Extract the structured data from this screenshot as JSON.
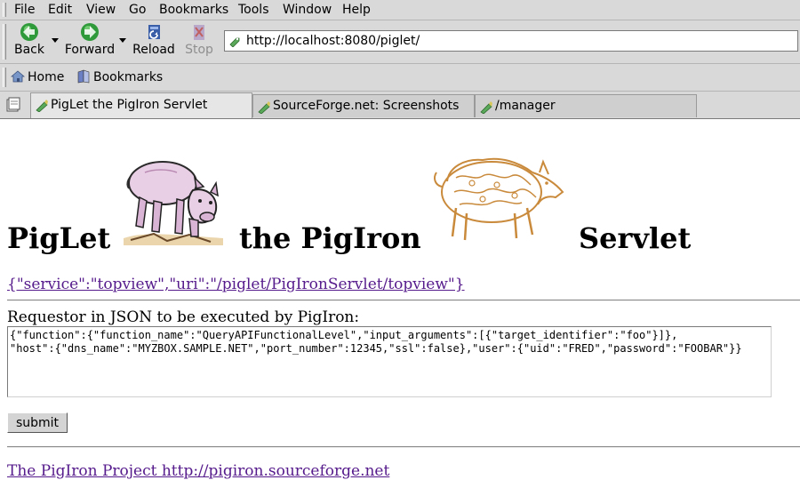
{
  "menubar": {
    "items": [
      {
        "label": "File"
      },
      {
        "label": "Edit"
      },
      {
        "label": "View"
      },
      {
        "label": "Go"
      },
      {
        "label": "Bookmarks"
      },
      {
        "label": "Tools"
      },
      {
        "label": "Window"
      },
      {
        "label": "Help"
      }
    ]
  },
  "navbar": {
    "back_label": "Back",
    "forward_label": "Forward",
    "reload_label": "Reload",
    "stop_label": "Stop",
    "url": "http://localhost:8080/piglet/"
  },
  "personalbar": {
    "home_label": "Home",
    "bookmarks_label": "Bookmarks"
  },
  "tabs": [
    {
      "title": "PigLet the PigIron Servlet",
      "active": true
    },
    {
      "title": "SourceForge.net: Screenshots",
      "active": false
    },
    {
      "title": "/manager",
      "active": false
    }
  ],
  "page": {
    "heading_words": [
      "PigLet",
      "the PigIron",
      "Servlet"
    ],
    "topview_link": "{\"service\":\"topview\",\"uri\":\"/piglet/PigIronServlet/topview\"}",
    "requestor_label": "Requestor in JSON to be executed by PigIron:",
    "requestor_value": "{\"function\":{\"function_name\":\"QueryAPIFunctionalLevel\",\"input_arguments\":[{\"target_identifier\":\"foo\"}]},\n\"host\":{\"dns_name\":\"MYZBOX.SAMPLE.NET\",\"port_number\":12345,\"ssl\":false},\"user\":{\"uid\":\"FRED\",\"password\":\"FOOBAR\"}}",
    "submit_label": "submit",
    "footer_link": "The PigIron Project http://pigiron.sourceforge.net"
  },
  "colors": {
    "chrome": "#d9d9d9",
    "link": "#551a8b",
    "pig_pink": "#e9cfe6",
    "pig_gold": "#c98a3c"
  }
}
